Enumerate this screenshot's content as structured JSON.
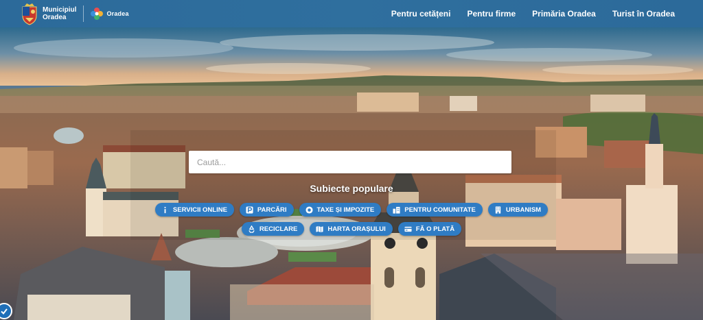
{
  "header": {
    "logo_line1": "Municipiul",
    "logo_line2": "Oradea",
    "brand": "Oradea",
    "nav": [
      "Pentru cetățeni",
      "Pentru firme",
      "Primăria Oradea",
      "Turist în Oradea"
    ]
  },
  "search": {
    "placeholder": "Caută..."
  },
  "popular": {
    "title": "Subiecte populare",
    "row1": [
      "SERVICII ONLINE",
      "PARCĂRI",
      "TAXE ȘI IMPOZITE",
      "PENTRU COMUNITATE",
      "URBANISM"
    ],
    "row2": [
      "RECICLARE",
      "HARTA ORAȘULUI",
      "FĂ O PLATĂ"
    ]
  },
  "colors": {
    "header": "#2f6f9e",
    "chip": "#2f7cc4"
  }
}
